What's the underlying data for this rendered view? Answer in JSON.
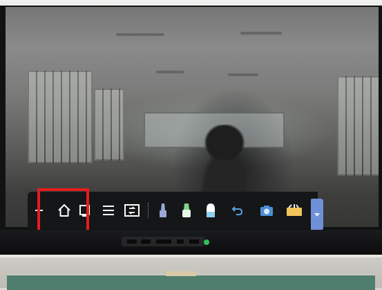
{
  "toolbar": {
    "items": [
      {
        "name": "back-icon"
      },
      {
        "name": "home-icon"
      },
      {
        "name": "window-icon"
      },
      {
        "name": "menu-icon"
      },
      {
        "name": "switch-source-icon"
      },
      {
        "name": "marker-pen-icon"
      },
      {
        "name": "highlighter-icon"
      },
      {
        "name": "eraser-icon"
      },
      {
        "name": "undo-icon"
      },
      {
        "name": "camera-icon"
      },
      {
        "name": "toolbox-icon"
      },
      {
        "name": "collapse-arrow-icon"
      }
    ],
    "colors": {
      "background": "#151617",
      "icon": "#ffffff",
      "marker": "#9aa8d8",
      "highlighter": "#7fd48a",
      "eraser": "#8fd0f0",
      "undo": "#5aa0e0",
      "camera": "#4a8fd8",
      "toolbox": "#f2c45a",
      "collapse_tab": "#6f8fd8"
    }
  },
  "highlight": {
    "color": "#e51c1c",
    "target": "home-and-window-buttons"
  },
  "status": {
    "power_led_color": "#2fbf5f"
  }
}
